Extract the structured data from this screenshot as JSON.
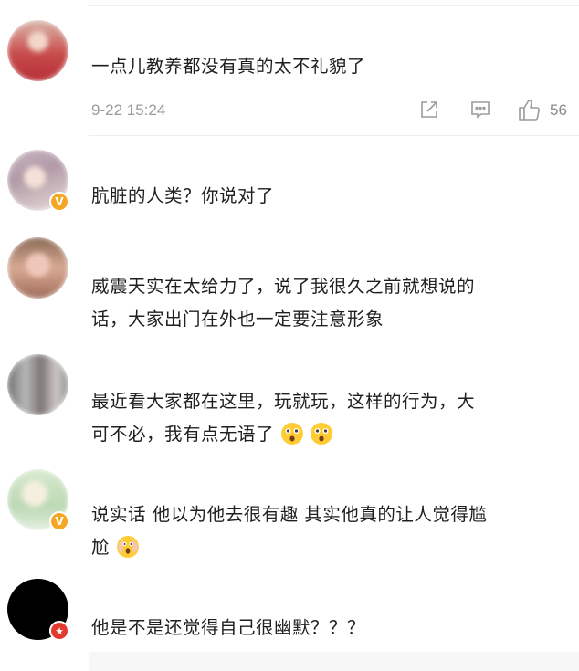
{
  "comments": [
    {
      "text": "一点儿教养都没有真的太不礼貌了",
      "time": "9-22 15:24",
      "likes": "56"
    },
    {
      "text": "肮脏的人类？你说对了"
    },
    {
      "line1": "威震天实在太给力了，说了我很久之前就想说的",
      "line2": "话，大家出门在外也一定要注意形象"
    },
    {
      "line1": "最近看大家都在这里，玩就玩，这样的行为，大",
      "line2": "可不必，我有点无语了"
    },
    {
      "line1": "说实话 他以为他去很有趣 其实他真的让人觉得尴",
      "line2": "尬"
    },
    {
      "text": "他是不是还觉得自己很幽默？？？"
    }
  ],
  "icons": {
    "share": "share-icon",
    "comment": "comment-icon",
    "like": "thumbs-up-icon",
    "verified": "verified-badge-icon",
    "emoji_astonished": "astonished-face-emoji",
    "emoji_scream": "screaming-face-emoji"
  },
  "colors": {
    "text": "#1f1f1f",
    "meta": "#9b9b9b",
    "verified": "#f5a623",
    "red_badge": "#e23a2f"
  }
}
